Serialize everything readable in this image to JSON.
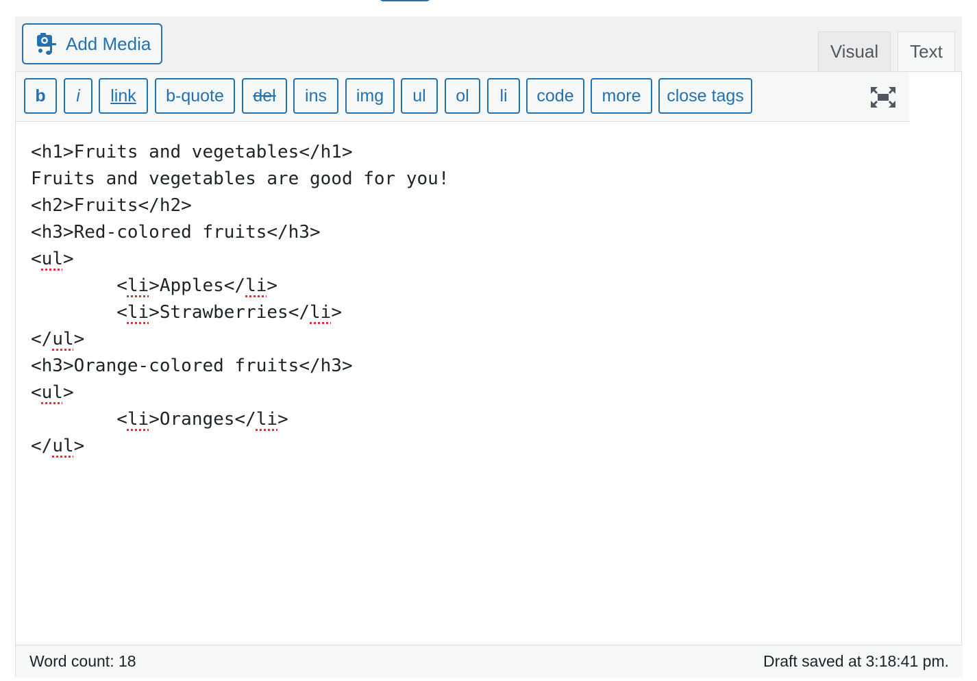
{
  "toolbar": {
    "add_media_label": "Add Media",
    "tabs": {
      "visual": "Visual",
      "text": "Text"
    },
    "buttons": [
      "b",
      "i",
      "link",
      "b-quote",
      "del",
      "ins",
      "img",
      "ul",
      "ol",
      "li",
      "code",
      "more",
      "close tags"
    ]
  },
  "editor": {
    "lines": [
      "<h1>Fruits and vegetables</h1>",
      "Fruits and vegetables are good for you!",
      "<h2>Fruits</h2>",
      "<h3>Red-colored fruits</h3>",
      "<ul>",
      "\t<li>Apples</li>",
      "\t<li>Strawberries</li>",
      "</ul>",
      "<h3>Orange-colored fruits</h3>",
      "<ul>",
      "\t<li>Oranges</li>",
      "</ul>"
    ]
  },
  "status": {
    "word_count": "Word count: 18",
    "draft_saved": "Draft saved at 3:18:41 pm."
  },
  "colors": {
    "accent": "#2271b1",
    "spellcheck": "#d63638",
    "toolbar_bg": "#f6f7f7"
  },
  "icons": {
    "add_media": "camera-music-icon",
    "fullscreen": "fullscreen-icon"
  }
}
